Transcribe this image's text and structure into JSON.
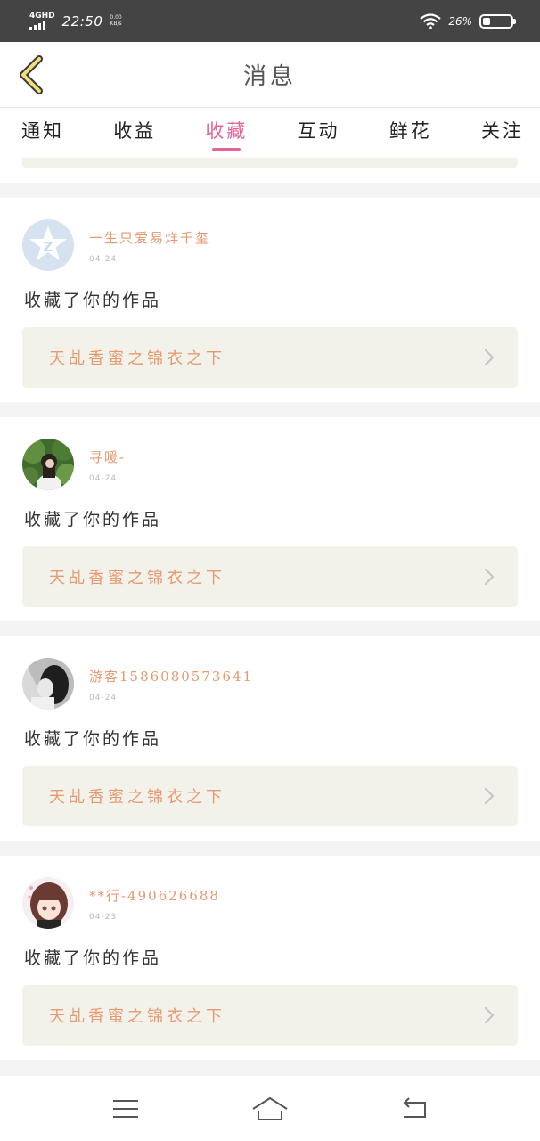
{
  "status_bar": {
    "network": "4GHD",
    "time": "22:50",
    "speed_value": "0.00",
    "speed_unit": "KB/s",
    "battery": "26%"
  },
  "header": {
    "title": "消息",
    "back_icon": "chevron-left-icon"
  },
  "tabs": [
    {
      "label": "通知",
      "active": false
    },
    {
      "label": "收益",
      "active": false
    },
    {
      "label": "收藏",
      "active": true
    },
    {
      "label": "互动",
      "active": false
    },
    {
      "label": "鲜花",
      "active": false
    },
    {
      "label": "关注",
      "active": false
    }
  ],
  "accent_color": "#e2649a",
  "name_color": "#e69a72",
  "messages": [
    {
      "username": "一生只爱易烊千玺",
      "date": "04-24",
      "action": "收藏了你的作品",
      "work_title": "天乩香蜜之锦衣之下",
      "avatar": "default-star-avatar"
    },
    {
      "username": "寻暖-",
      "date": "04-24",
      "action": "收藏了你的作品",
      "work_title": "天乩香蜜之锦衣之下",
      "avatar": "girl-forest-avatar"
    },
    {
      "username": "游客1586080573641",
      "date": "04-24",
      "action": "收藏了你的作品",
      "work_title": "天乩香蜜之锦衣之下",
      "avatar": "bw-portrait-avatar"
    },
    {
      "username": "**行-490626688",
      "date": "04-23",
      "action": "收藏了你的作品",
      "work_title": "天乩香蜜之锦衣之下",
      "avatar": "anime-girl-avatar"
    }
  ],
  "nav_bar": {
    "menu_icon": "menu-icon",
    "home_icon": "home-icon",
    "back_icon": "back-arrow-icon"
  }
}
